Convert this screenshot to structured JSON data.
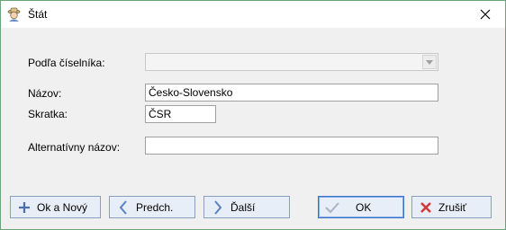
{
  "window": {
    "title": "Štát",
    "app_icon": "person-with-hat-icon",
    "close_icon": "close-icon"
  },
  "form": {
    "podla_label": "Podľa číselníka:",
    "podla_value": "",
    "nazov_label": "Názov:",
    "nazov_value": "Česko-Slovensko",
    "skratka_label": "Skratka:",
    "skratka_value": "ČSR",
    "alt_label": "Alternatívny názov:",
    "alt_value": ""
  },
  "buttons": {
    "ok_novy": {
      "label": "Ok a Nový",
      "icon": "plus-icon"
    },
    "predch": {
      "label": "Predch.",
      "icon": "chevron-left-icon"
    },
    "dalsi": {
      "label": "Ďalší",
      "icon": "chevron-right-icon"
    },
    "ok": {
      "label": "OK",
      "icon": "checkmark-icon"
    },
    "zrusit": {
      "label": "Zrušiť",
      "icon": "x-cancel-icon"
    }
  },
  "colors": {
    "window_border": "#6aa37a",
    "button_bg": "#e8eef7",
    "button_border": "#8a9fbf",
    "default_button_border": "#3b73c8"
  }
}
